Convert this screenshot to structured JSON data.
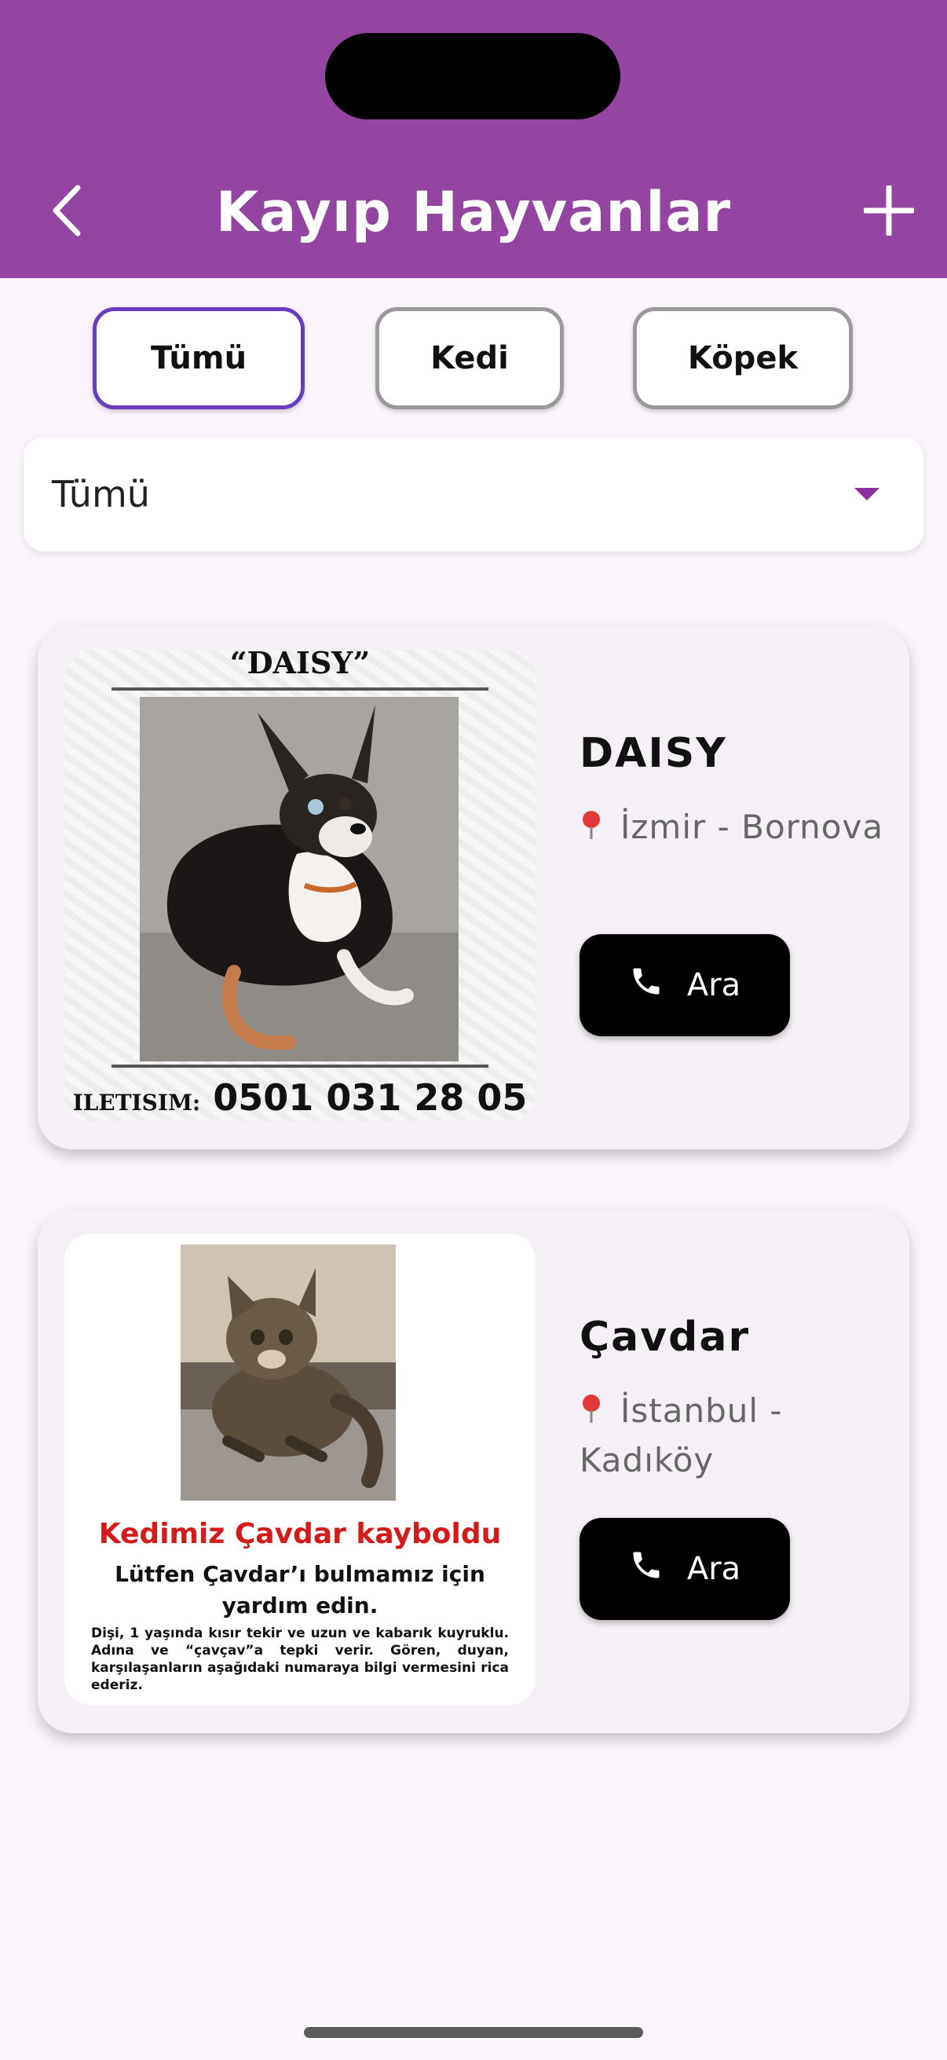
{
  "header": {
    "title": "Kayıp Hayvanlar",
    "background": "#9345a1",
    "back_icon": "chevron-left-icon",
    "add_icon": "plus-icon"
  },
  "filters": {
    "chips": [
      "Tümü",
      "Kedi",
      "Köpek"
    ],
    "selected": "Tümü"
  },
  "dropdown": {
    "value": "Tümü",
    "icon": "caret-down-icon"
  },
  "pets": [
    {
      "name": "DAISY",
      "location": "İzmir - Bornova",
      "call_label": "Ara",
      "poster": {
        "title": "“DAISY”",
        "contact_label": "ILETISIM:",
        "contact_phone": "0501 031 28 05"
      }
    },
    {
      "name": "Çavdar",
      "location": "İstanbul - Kadıköy",
      "call_label": "Ara",
      "poster": {
        "headline": "Kedimiz Çavdar kayboldu",
        "subline": "Lütfen Çavdar’ı bulmamız için yardım edin.",
        "body": "Dişi, 1 yaşında kısır tekir ve uzun ve kabarık kuyruklu. Adına ve “çavçav”a tepki verir. Gören, duyan, karşılaşanların aşağıdaki numaraya bilgi vermesini rica ederiz."
      }
    }
  ],
  "colors": {
    "accent": "#8e2fa0",
    "active_chip_border": "#6a3cc0",
    "card_bg": "#f5f0f6",
    "page_bg": "#fcf4fc"
  }
}
